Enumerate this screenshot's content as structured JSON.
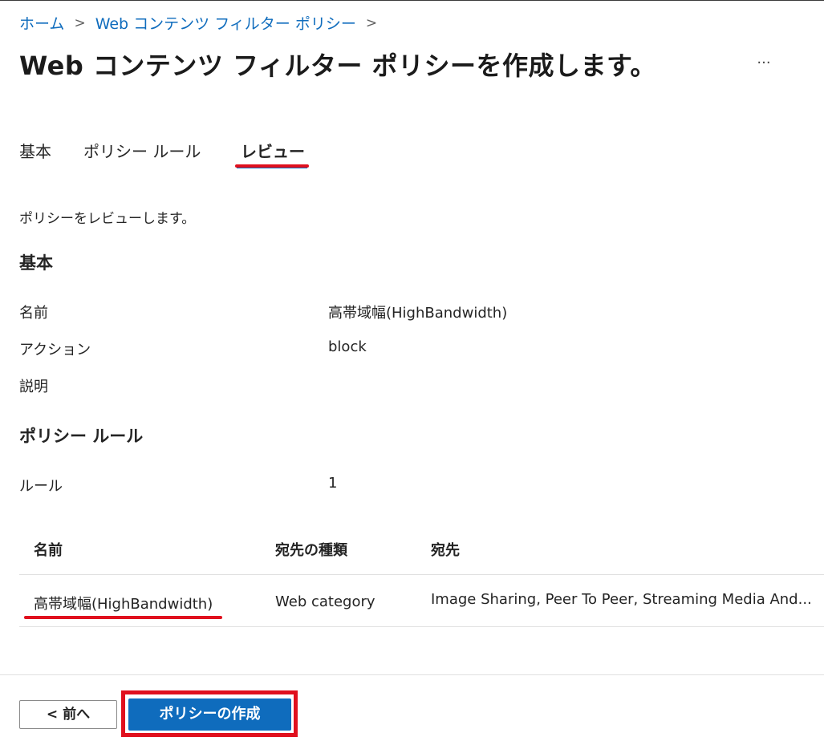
{
  "breadcrumb": {
    "items": [
      "ホーム",
      "Web コンテンツ フィルター ポリシー"
    ],
    "separator": ">"
  },
  "page": {
    "title": "Web コンテンツ フィルター ポリシーを作成します。",
    "more_label": "···"
  },
  "tabs": [
    {
      "label": "基本",
      "active": false
    },
    {
      "label": "ポリシー ルール",
      "active": false
    },
    {
      "label": "レビュー",
      "active": true
    }
  ],
  "review": {
    "intro": "ポリシーをレビューします。",
    "basics": {
      "heading": "基本",
      "fields": [
        {
          "label": "名前",
          "value": "高帯域幅(HighBandwidth)"
        },
        {
          "label": "アクション",
          "value": "block"
        },
        {
          "label": "説明",
          "value": ""
        }
      ]
    },
    "rules": {
      "heading": "ポリシー ルール",
      "count_label": "ルール",
      "count_value": "1",
      "table": {
        "columns": [
          "名前",
          "宛先の種類",
          "宛先"
        ],
        "rows": [
          [
            "高帯域幅(HighBandwidth)",
            "Web category",
            "Image Sharing, Peer To Peer, Streaming Media And..."
          ]
        ]
      }
    }
  },
  "footer": {
    "prev_label": "< 前へ",
    "create_label": "ポリシーの作成"
  },
  "colors": {
    "accent": "#0f6cbd",
    "annotation_red": "#e0101e",
    "text": "#242424"
  }
}
